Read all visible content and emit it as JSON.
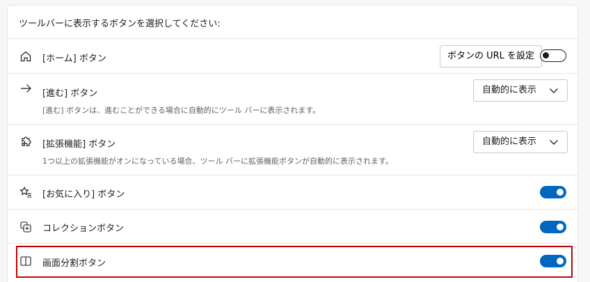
{
  "header": {
    "title": "ツールバーに表示するボタンを選択してください:"
  },
  "rows": {
    "home": {
      "label": "[ホーム] ボタン",
      "icon": "home-icon",
      "set_url_button": "ボタンの URL を設定",
      "toggle_on": false
    },
    "forward": {
      "label": "[進む] ボタン",
      "icon": "arrow-right-icon",
      "description": "[進む] ボタンは、進むことができる場合に自動的にツール バーに表示されます。",
      "dropdown_value": "自動的に表示"
    },
    "extensions": {
      "label": "[拡張機能] ボタン",
      "icon": "puzzle-icon",
      "description": "1つ以上の拡張機能がオンになっている場合、ツール バーに拡張機能ボタンが自動的に表示されます。",
      "dropdown_value": "自動的に表示"
    },
    "favorites": {
      "label": "[お気に入り] ボタン",
      "icon": "star-list-icon",
      "toggle_on": true
    },
    "collections": {
      "label": "コレクションボタン",
      "icon": "collections-icon",
      "toggle_on": true
    },
    "split_screen": {
      "label": "画面分割ボタン",
      "icon": "split-screen-icon",
      "toggle_on": true
    }
  },
  "colors": {
    "accent": "#0067c0",
    "highlight_border": "#c00000",
    "border": "#e5e5e5"
  }
}
